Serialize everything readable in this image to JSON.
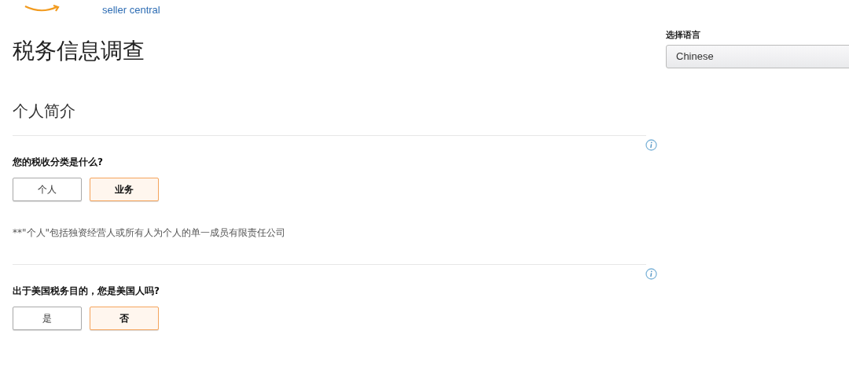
{
  "logo": {
    "subtitle": "seller central"
  },
  "title": "税务信息调查",
  "language": {
    "label": "选择语言",
    "value": "Chinese"
  },
  "section": "个人简介",
  "questions": [
    {
      "text": "您的税收分类是什么?",
      "options": [
        {
          "label": "个人",
          "selected": false
        },
        {
          "label": "业务",
          "selected": true
        }
      ],
      "note": "**\"个人\"包括独资经营人或所有人为个人的单一成员有限责任公司"
    },
    {
      "text": "出于美国税务目的，您是美国人吗?",
      "options": [
        {
          "label": "是",
          "selected": false
        },
        {
          "label": "否",
          "selected": true
        }
      ]
    }
  ]
}
